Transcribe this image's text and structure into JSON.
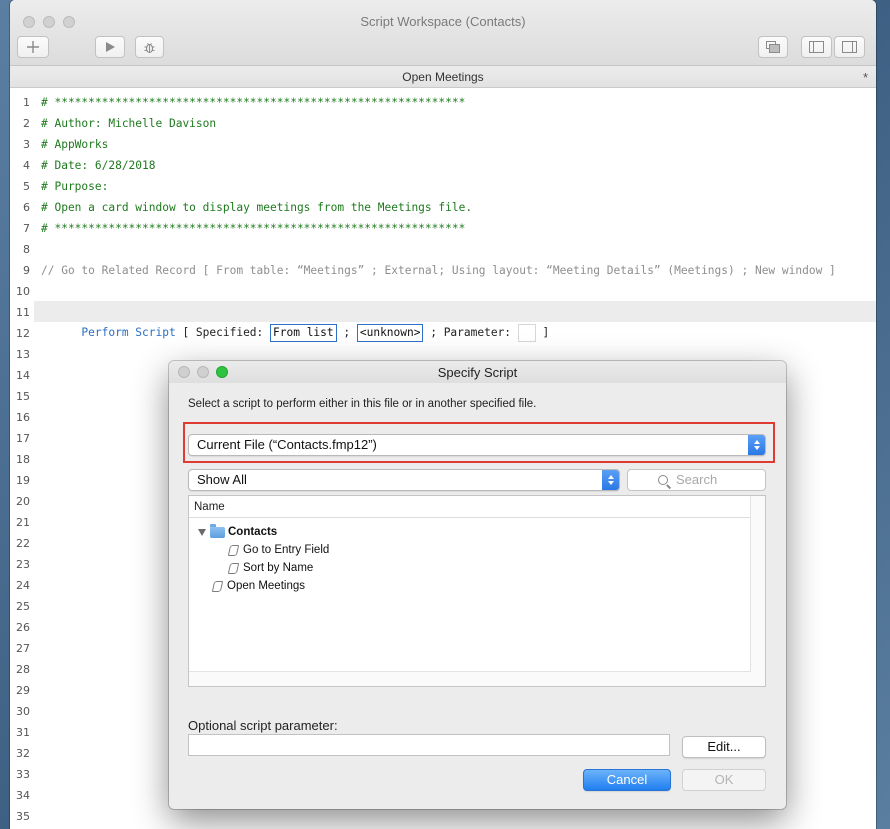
{
  "window": {
    "title": "Script Workspace (Contacts)",
    "tab_title": "Open Meetings",
    "tab_modified": "*"
  },
  "toolbar": {
    "new_icon": "plus-icon",
    "run_icon": "play-icon",
    "debug_icon": "bug-icon",
    "windows_icon": "stack-windows-icon",
    "left_pane_icon": "left-sidebar-icon",
    "right_pane_icon": "right-sidebar-icon"
  },
  "line_numbers": [
    "1",
    "2",
    "3",
    "4",
    "5",
    "6",
    "7",
    "8",
    "9",
    "10",
    "11",
    "12",
    "13",
    "14",
    "15",
    "16",
    "17",
    "18",
    "19",
    "20",
    "21",
    "22",
    "23",
    "24",
    "25",
    "26",
    "27",
    "28",
    "29",
    "30",
    "31",
    "32",
    "33",
    "34",
    "35"
  ],
  "code": {
    "l1": "# *************************************************************",
    "l2": "# Author: Michelle Davison",
    "l3": "# AppWorks",
    "l4": "# Date: 6/28/2018",
    "l5": "# Purpose:",
    "l6": "# Open a card window to display meetings from the Meetings file.",
    "l7": "# *************************************************************",
    "l9": "// Go to Related Record [ From table: “Meetings” ; External; Using layout: “Meeting Details” (Meetings) ; New window ]",
    "l11": {
      "step": "Perform Script",
      "open": " [ Specified: ",
      "specified_value": "From list",
      "sep": " ; ",
      "script_value": "<unknown>",
      "param_label": " ; Parameter: ",
      "close": " ]"
    }
  },
  "dialog": {
    "title": "Specify Script",
    "description": "Select a script to perform either in this file or in another specified file.",
    "file_popup": "Current File (“Contacts.fmp12”)",
    "filter_popup": "Show All",
    "search_placeholder": "Search",
    "list_header": "Name",
    "tree": {
      "folder": "Contacts",
      "folder_scripts": [
        "Go to Entry Field",
        "Sort by Name"
      ],
      "root_script": "Open Meetings"
    },
    "param_label": "Optional script parameter:",
    "edit_button": "Edit...",
    "cancel_button": "Cancel",
    "ok_button": "OK"
  },
  "colors": {
    "comment_green": "#1f7a1f",
    "disabled_grey": "#8e8e8e",
    "step_blue": "#2a6fc4",
    "highlight_red": "#e03b32",
    "accent_blue": "#1f7ef0"
  }
}
